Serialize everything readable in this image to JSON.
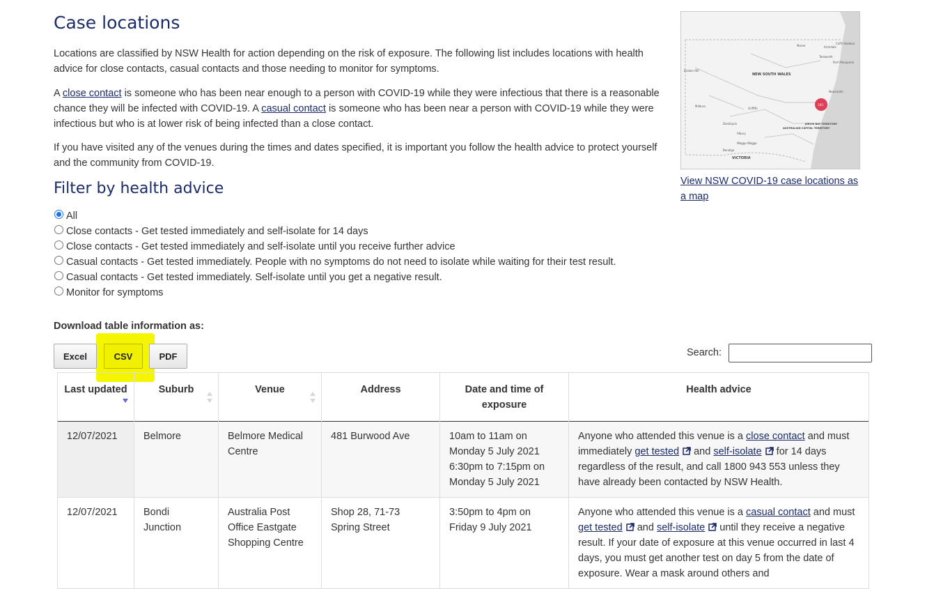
{
  "headings": {
    "case_locations": "Case locations",
    "filter": "Filter by health advice"
  },
  "intro": {
    "p1": "Locations are classified by NSW Health for action depending on the risk of exposure. The following list includes locations with health advice for close contacts, casual contacts and those needing to monitor for symptoms.",
    "p2_before": "A ",
    "p2_link1": "close contact",
    "p2_mid": " is someone who has been near enough to a person with COVID-19 while they were infectious that there is a reasonable chance they will be infected with COVID-19. A ",
    "p2_link2": "casual contact",
    "p2_after": " is someone who has been near a person with COVID-19 while they were infectious but who is at lower risk of being infected than a close contact.",
    "p3": "If you have visited any of the venues during the times and dates specified, it is important you follow the health advice to protect yourself and the community from COVID-19."
  },
  "filters": [
    {
      "label": "All",
      "checked": true
    },
    {
      "label": "Close contacts - Get tested immediately and self-isolate for 14 days",
      "checked": false
    },
    {
      "label": "Close contacts - Get tested immediately and self-isolate until you receive further advice",
      "checked": false
    },
    {
      "label": "Casual contacts - Get tested immediately. People with no symptoms do not need to isolate while waiting for their test result.",
      "checked": false
    },
    {
      "label": "Casual contacts - Get tested immediately. Self-isolate until you get a negative result.",
      "checked": false
    },
    {
      "label": "Monitor for symptoms",
      "checked": false
    }
  ],
  "download": {
    "label": "Download table information as:",
    "excel": "Excel",
    "csv": "CSV",
    "pdf": "PDF"
  },
  "search": {
    "label": "Search:",
    "value": ""
  },
  "map": {
    "link_text": "View NSW COVID-19 case locations as a map",
    "labels": {
      "nsw": "NEW SOUTH WALES",
      "victoria": "VICTORIA",
      "act": "AUSTRALIAN CAPITAL TERRITORY",
      "jervis": "JERVIS BAY TERRITORY",
      "newcastle": "Newcastle",
      "broken_hill": "Broken Hill",
      "mildura": "Mildura",
      "griffith": "Griffith",
      "wagga": "Wagga Wagga",
      "tamworth": "Tamworth",
      "moree": "Moree",
      "armidale": "Armidale",
      "coffs": "Coffs Harbour",
      "port_macquarie": "Port Macquarie",
      "deniliquin": "Deniliquin",
      "bendigo": "Bendigo",
      "albury": "Albury",
      "cluster_count": "181"
    }
  },
  "table": {
    "headers": [
      "Last updated",
      "Suburb",
      "Venue",
      "Address",
      "Date and time of exposure",
      "Health advice"
    ],
    "rows": [
      {
        "updated": "12/07/2021",
        "suburb": "Belmore",
        "venue": "Belmore Medical Centre",
        "address": "481 Burwood Ave",
        "time1": "10am to 11am on Monday 5 July 2021",
        "time2": "6:30pm to 7:15pm on Monday 5 July 2021",
        "advice": {
          "a": "Anyone who attended this venue is a ",
          "link1": "close contact",
          "b": " and must immediately ",
          "link2": "get tested",
          "c": " and ",
          "link3": "self-isolate",
          "d": " for 14 days regardless of the result, and call 1800 943 553 unless they have already been contacted by NSW Health."
        }
      },
      {
        "updated": "12/07/2021",
        "suburb": "Bondi Junction",
        "venue": "Australia Post Office Eastgate Shopping Centre",
        "address": "Shop 28, 71-73 Spring Street",
        "time1": "3:50pm to 4pm on Friday 9 July 2021",
        "time2": "",
        "advice": {
          "a": "Anyone who attended this venue is a ",
          "link1": "casual contact",
          "b": " and must ",
          "link2": "get tested",
          "c": " and ",
          "link3": "self-isolate",
          "d": " until they receive a negative result. If your date of exposure at this venue occurred in last 4 days, you must get another test on day 5 from the date of exposure. Wear a mask around others and"
        }
      }
    ]
  },
  "colors": {
    "heading": "#1b2b6a",
    "link": "#1b2b6a",
    "highlight": "#f5f500",
    "radio_checked": "#1a73e8",
    "cluster": "#d81e3a"
  }
}
